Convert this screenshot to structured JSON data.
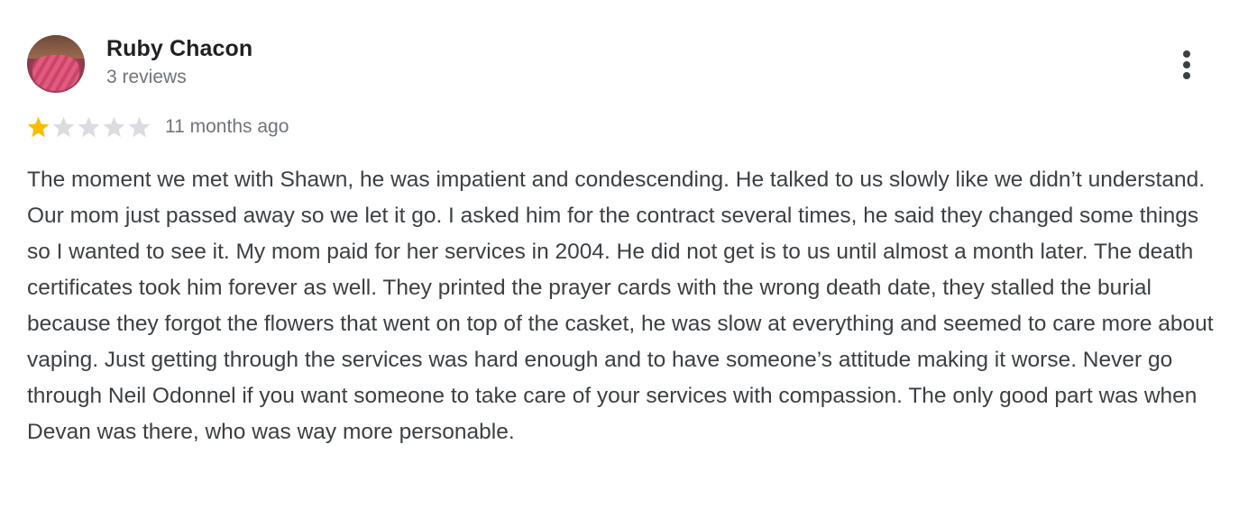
{
  "review": {
    "author": {
      "name": "Ruby Chacon",
      "meta": "3 reviews"
    },
    "rating": {
      "value": 1,
      "max": 5,
      "filled_color": "#fbbc04",
      "empty_color": "#dadce0"
    },
    "date": "11 months ago",
    "text": "The moment we met with Shawn, he was impatient and condescending. He talked to us slowly like we didn’t understand. Our mom just passed away so we let it go. I asked him for the contract several times, he said they changed some things so I wanted to see it. My mom paid for her services in 2004. He did not get is to us until almost a month later. The death certificates took him forever as well. They printed the prayer cards with the wrong death date, they stalled the burial because they forgot the flowers that went on top of the casket, he was slow at everything and seemed to care more about vaping. Just getting through the services was hard enough and to have someone’s attitude making it worse. Never go through Neil Odonnel if you want someone to take care of your services with compassion. The only good part was when Devan was there, who was way more personable.",
    "menu_icon": "more-vert-icon"
  }
}
